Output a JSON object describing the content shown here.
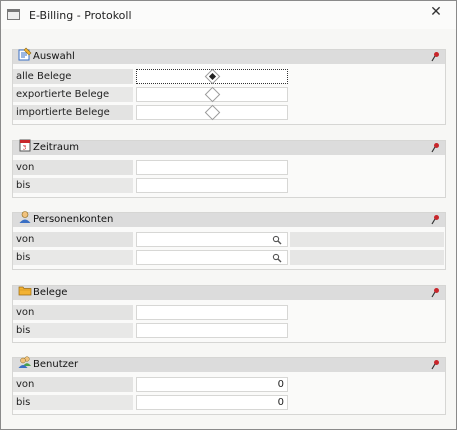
{
  "window": {
    "title": "E-Billing - Protokoll"
  },
  "sections": {
    "auswahl": {
      "title": "Auswahl",
      "rows": [
        {
          "label": "alle Belege",
          "selected": true
        },
        {
          "label": "exportierte Belege",
          "selected": false
        },
        {
          "label": "importierte Belege",
          "selected": false
        }
      ]
    },
    "zeitraum": {
      "title": "Zeitraum",
      "rows": [
        {
          "label": "von",
          "value": ""
        },
        {
          "label": "bis",
          "value": ""
        }
      ]
    },
    "personenkonten": {
      "title": "Personenkonten",
      "rows": [
        {
          "label": "von",
          "value": ""
        },
        {
          "label": "bis",
          "value": ""
        }
      ]
    },
    "belege": {
      "title": "Belege",
      "rows": [
        {
          "label": "von",
          "value": ""
        },
        {
          "label": "bis",
          "value": ""
        }
      ]
    },
    "benutzer": {
      "title": "Benutzer",
      "rows": [
        {
          "label": "von",
          "value": "0"
        },
        {
          "label": "bis",
          "value": "0"
        }
      ]
    }
  },
  "colors": {
    "header_bg": "#dcdcdc",
    "label_bg": "#e3e3e2",
    "pin_red": "#c8262b"
  },
  "icons": [
    "window-icon",
    "close-icon",
    "note-icon",
    "calendar-icon",
    "person-icon",
    "folder-icon",
    "users-icon",
    "pin-icon",
    "search-icon"
  ]
}
